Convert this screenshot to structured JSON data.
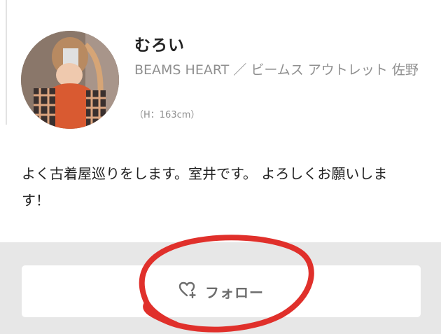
{
  "profile": {
    "name": "むろい",
    "shop": "BEAMS HEART ／ ビームス アウトレット 佐野",
    "height": "（H：163cm）",
    "bio": "よく古着屋巡りをします。室井です。 よろしくお願いします！"
  },
  "follow": {
    "label": "フォロー",
    "icon": "heart-plus-icon"
  },
  "colors": {
    "annotation": "#e0302b",
    "footer_background": "#e7e7e7",
    "muted_text": "#8f8f8f"
  }
}
